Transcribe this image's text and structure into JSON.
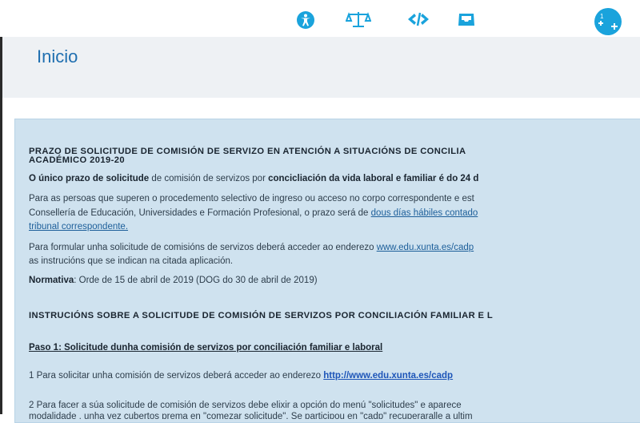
{
  "header": {
    "title": "Inicio"
  },
  "toolbar": {
    "icons": [
      "accessibility-icon",
      "legal-icon",
      "code-icon",
      "inbox-icon",
      "faces-icon"
    ],
    "badge": "1"
  },
  "panel": {
    "heading_1": "PRAZO DE SOLICITUDE DE COMISIÓN DE SERVIZO EN ATENCIÓN A SITUACIÓNS DE CONCILIA",
    "heading_2": "ACADÉMICO 2019-20",
    "p1_bold1": "O único prazo de solicitude",
    "p1_text": " de comisión de servizos por ",
    "p1_bold2": "concicliación da vida laboral e familiar é do 24 d",
    "p2_line1": "Para as persoas que superen o procedemento selectivo de ingreso ou acceso no corpo correspondente e est",
    "p2_line2_text": "Consellería de Educación, Universidades e Formación Profesional, o prazo será de ",
    "p2_line2_link": "dous días hábiles contado",
    "p2_line3_link": "tribunal correspondente.",
    "p3_line1_text": "Para formular unha solicitude de comisións de servizos deberá acceder ao enderezo ",
    "p3_line1_link": "www.edu.xunta.es/cadp",
    "p3_line2": "as instrucións que se indican na citada aplicación.",
    "normativa_label": "Normativa",
    "normativa_text": ": Orde de 15 de abril de 2019 (DOG do 30 de abril de 2019)",
    "instructions_heading": "INSTRUCIÓNS SOBRE A SOLICITUDE DE COMISIÓN DE SERVIZOS POR CONCILIACIÓN FAMILIAR E L",
    "step1_heading": "Paso 1: Solicitude dunha comisión de servizos por conciliación familiar e laboral",
    "step1_text": "1 Para solicitar unha comisión de servizos deberá acceder ao enderezo ",
    "step1_link": "http://www.edu.xunta.es/cadp",
    "step2_line1": "2 Para facer a súa solicitude de comisión de servizos debe elixir a opción do menú \"solicitudes\" e aparece",
    "step2_line2": "modalidade , unha vez cubertos prema en \"comezar solicitude\". Se participou en \"cadp\" recuperaralle a ultim"
  },
  "colors": {
    "accent": "#1f6fb0",
    "panel_bg": "#cfe2ef",
    "header_bg": "#eef1f4"
  }
}
